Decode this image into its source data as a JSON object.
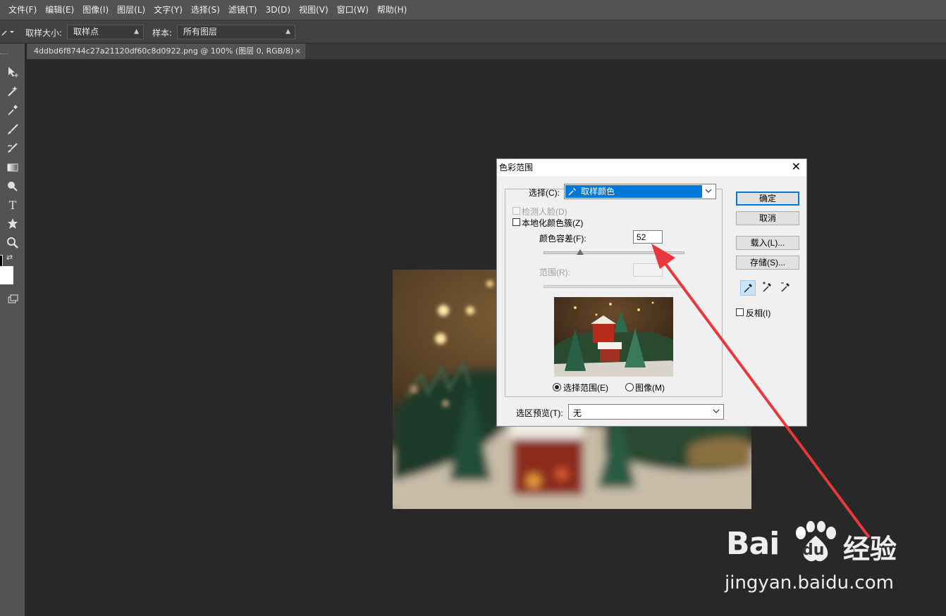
{
  "menubar": {
    "items": [
      "文件(F)",
      "编辑(E)",
      "图像(I)",
      "图层(L)",
      "文字(Y)",
      "选择(S)",
      "滤镜(T)",
      "3D(D)",
      "视图(V)",
      "窗口(W)",
      "帮助(H)"
    ]
  },
  "options_bar": {
    "sample_size_label": "取样大小:",
    "sample_size_value": "取样点",
    "sample_label": "样本:",
    "sample_value": "所有图层"
  },
  "document_tab": {
    "title": "4ddbd6f8744c27a21120df60c8d0922.png @ 100% (图层 0, RGB/8)",
    "close": "×"
  },
  "toolbar": {
    "tools": [
      "move-tool-icon",
      "magic-wand-icon",
      "eyedropper-icon",
      "brush-icon",
      "history-brush-icon",
      "gradient-icon",
      "dodge-icon",
      "type-tool-icon",
      "shape-tool-icon",
      "zoom-tool-icon",
      "swap-colors-icon",
      "screen-mode-icon"
    ],
    "type_glyph": "T",
    "swap_glyph": "⇄"
  },
  "dialog": {
    "title": "色彩范围",
    "close": "✕",
    "select_label": "选择(C):",
    "select_value": "取样颜色",
    "detect_faces_label": "检测人脸(D)",
    "localized_label": "本地化颜色簇(Z)",
    "fuzziness_label": "颜色容差(F):",
    "fuzziness_value": "52",
    "fuzziness_fraction": 0.26,
    "range_label": "范围(R):",
    "range_value": "",
    "radio_selection": "选择范围(E)",
    "radio_image": "图像(M)",
    "preview_label": "选区预览(T):",
    "preview_value": "无",
    "buttons": {
      "ok": "确定",
      "cancel": "取消",
      "load": "载入(L)...",
      "save": "存储(S)..."
    },
    "invert_label": "反相(I)"
  },
  "watermark": {
    "brand": "Bai",
    "brand_du": "du",
    "brand_suffix": "经验",
    "url": "jingyan.baidu.com"
  },
  "colors": {
    "accent": "#0078d7",
    "arrow": "#e8383d",
    "ps_dark": "#282828",
    "ps_panel": "#535353"
  }
}
